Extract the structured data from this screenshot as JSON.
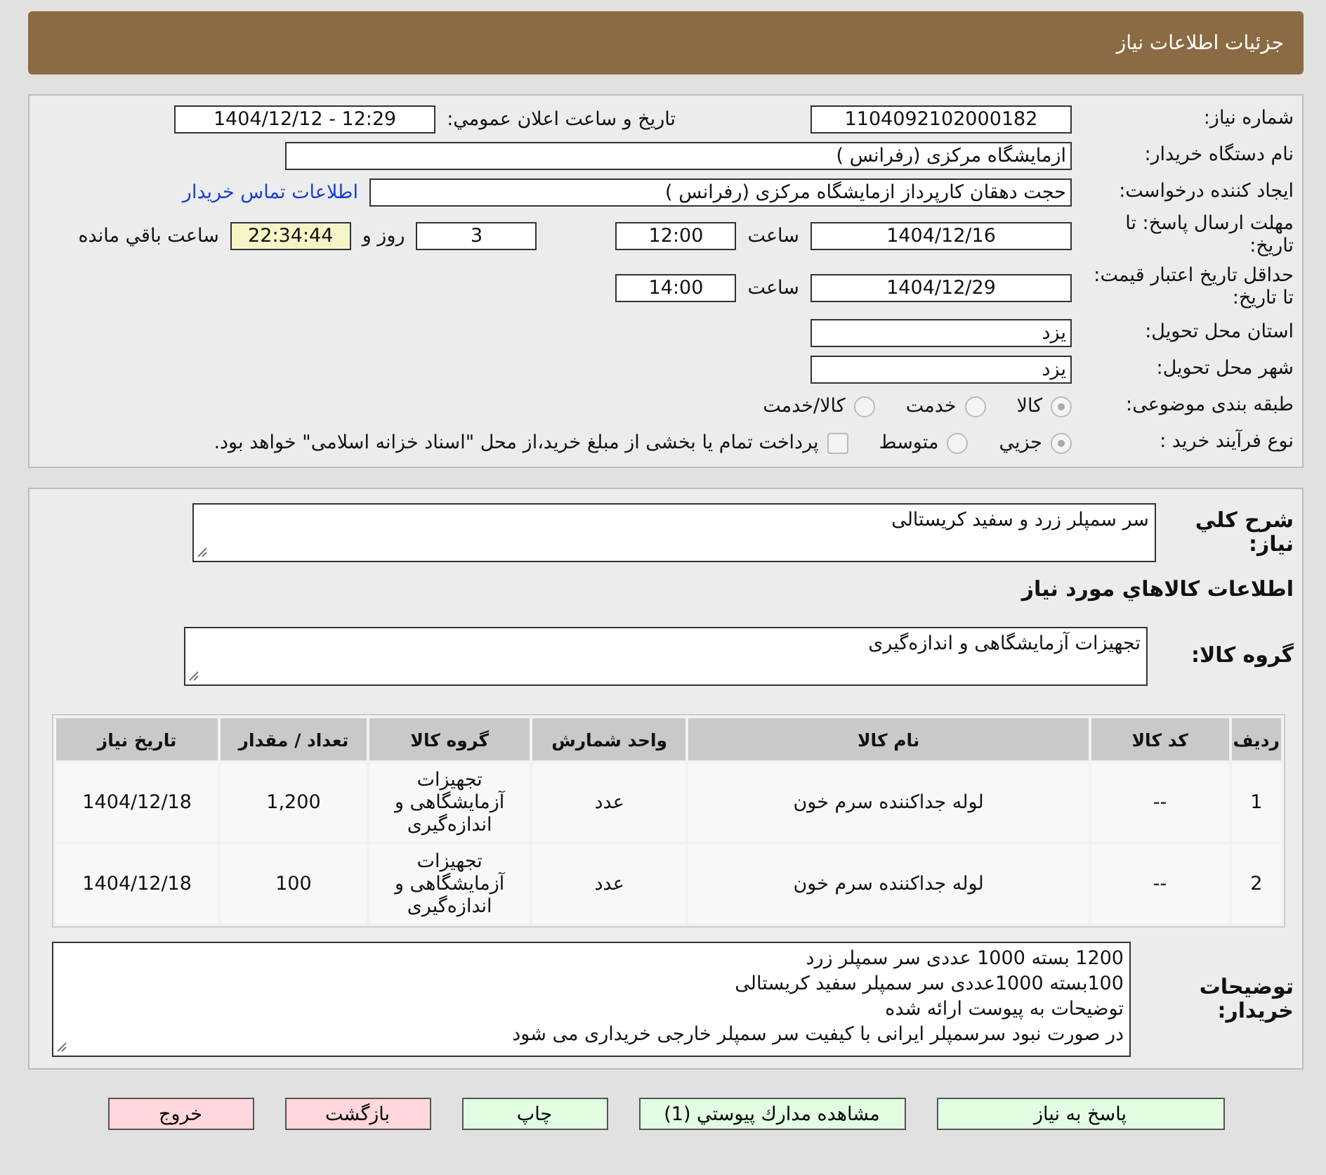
{
  "header": {
    "title": "جزئیات اطلاعات نیاز"
  },
  "need_number": {
    "label": "شماره نیاز:",
    "value": "1104092102000182"
  },
  "announce": {
    "label": "تاریخ و ساعت اعلان عمومي:",
    "value": "1404/12/12 - 12:29"
  },
  "buyer_org": {
    "label": "نام دستگاه خریدار:",
    "value": "ازمایشگاه مرکزی (رفرانس )"
  },
  "requester": {
    "label": "ایجاد کننده درخواست:",
    "value": "حجت دهقان کارپرداز ازمایشگاه مرکزی (رفرانس )",
    "link": "اطلاعات تماس خریدار"
  },
  "deadline": {
    "label": "مهلت ارسال پاسخ: تا تاریخ:",
    "date": "1404/12/16",
    "time_label": "ساعت",
    "time": "12:00",
    "days": "3",
    "days_label": "روز و",
    "remaining": "22:34:44",
    "remaining_label": "ساعت باقي مانده"
  },
  "validity": {
    "label": "حداقل تاریخ اعتبار قیمت: تا تاریخ:",
    "date": "1404/12/29",
    "time_label": "ساعت",
    "time": "14:00"
  },
  "province": {
    "label": "استان محل تحویل:",
    "value": "یزد"
  },
  "city": {
    "label": "شهر محل تحویل:",
    "value": "یزد"
  },
  "category": {
    "label": "طبقه بندی موضوعی:",
    "options": [
      {
        "label": "کالا",
        "selected": true
      },
      {
        "label": "خدمت",
        "selected": false
      },
      {
        "label": "کالا/خدمت",
        "selected": false
      }
    ]
  },
  "purchase_type": {
    "label": "نوع فرآیند خرید :",
    "options": [
      {
        "label": "جزيي",
        "selected": true
      },
      {
        "label": "متوسط",
        "selected": false
      }
    ],
    "payment": {
      "checked": false,
      "label": "پرداخت تمام یا بخشی از مبلغ خرید،از محل \"اسناد خزانه اسلامی\" خواهد بود."
    }
  },
  "description": {
    "label": "شرح كلي نیاز:",
    "value": "سر سمپلر زرد و سفید کریستالی"
  },
  "goods_title": "اطلاعات كالاهاي مورد نیاز",
  "goods_group": {
    "label": "گروه کالا:",
    "value": "تجهیزات آزمایشگاهی و اندازه‌گیری"
  },
  "table": {
    "columns": [
      "ردیف",
      "کد کالا",
      "نام کالا",
      "واحد شمارش",
      "گروه کالا",
      "تعداد / مقدار",
      "تاریخ نیاز"
    ],
    "rows": [
      [
        "1",
        "--",
        "لوله جداکننده سرم خون",
        "عدد",
        "تجهیزات آزمایشگاهی و اندازه‌گیری",
        "1,200",
        "1404/12/18"
      ],
      [
        "2",
        "--",
        "لوله جداکننده سرم خون",
        "عدد",
        "تجهیزات آزمایشگاهی و اندازه‌گیری",
        "100",
        "1404/12/18"
      ]
    ]
  },
  "buyer_notes": {
    "label": "توضیحات خریدار:",
    "lines": [
      "1200 بسته 1000 عددی سر سمپلر زرد",
      "100بسته 1000عددی سر سمپلر سفید کریستالی",
      "توضیحات به پیوست ارائه شده",
      "در صورت نبود سرسمپلر ایرانی با کیفیت سر سمپلر خارجی خریداری می شود"
    ]
  },
  "buttons": [
    {
      "label": "پاسخ به نیاز",
      "kind": "action"
    },
    {
      "label": "مشاهده مدارك پیوستي (1)",
      "kind": "action"
    },
    {
      "label": "چاپ",
      "kind": "action"
    },
    {
      "label": "بازگشت",
      "kind": "exit"
    },
    {
      "label": "خروج",
      "kind": "exit"
    }
  ]
}
